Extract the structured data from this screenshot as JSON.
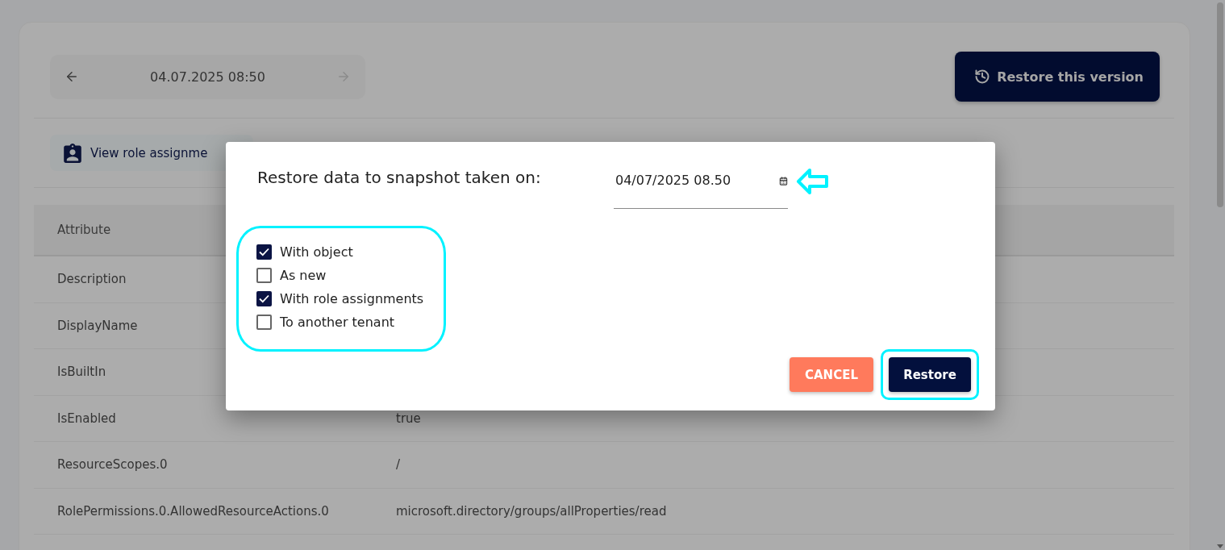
{
  "version_nav": {
    "date": "04.07.2025 08:50",
    "previous": {
      "disabled": false
    },
    "next": {
      "disabled": true
    }
  },
  "restore_version_button": {
    "label": "Restore this version"
  },
  "role_assignments_button": {
    "label": "View role assignme"
  },
  "table": {
    "header": "Attribute",
    "rows": [
      {
        "attribute": "Description"
      },
      {
        "attribute": "DisplayName"
      },
      {
        "attribute": "IsBuiltIn"
      },
      {
        "attribute": "IsEnabled",
        "value": "true"
      },
      {
        "attribute": "ResourceScopes.0",
        "value": "/"
      },
      {
        "attribute": "RolePermissions.0.AllowedResourceActions.0",
        "value": "microsoft.directory/groups/allProperties/read"
      }
    ]
  },
  "dialog": {
    "title": "Restore data to snapshot taken on:",
    "date_field": {
      "value": "04/07/2025 08.50",
      "pointer_arrow": true
    },
    "options": {
      "highlighted": true,
      "items": [
        {
          "label": "With object",
          "checked": true
        },
        {
          "label": "As new",
          "checked": false
        },
        {
          "label": "With role assignments",
          "checked": true
        },
        {
          "label": "To another tenant",
          "checked": false
        }
      ]
    },
    "buttons": [
      {
        "kind": "cancel",
        "label": "CANCEL",
        "highlighted": false
      },
      {
        "kind": "confirm",
        "label": "Restore",
        "highlighted": true
      }
    ]
  }
}
